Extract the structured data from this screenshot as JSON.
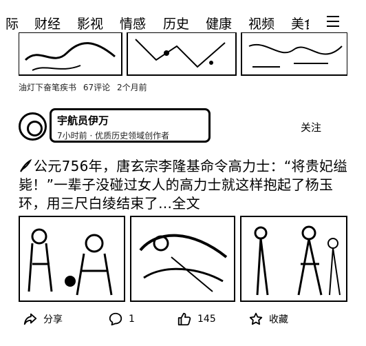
{
  "nav": {
    "tabs": [
      "际",
      "财经",
      "影视",
      "情感",
      "历史",
      "健康",
      "视频",
      "美食"
    ]
  },
  "prev_card": {
    "author": "油灯下奋笔疾书",
    "comments": "67评论",
    "time": "2个月前"
  },
  "author": {
    "name": "宇航员伊万",
    "subtitle": "7小时前 · 优质历史领域创作者",
    "follow": "关注"
  },
  "headline": "公元756年，唐玄宗李隆基命令高力士：“将贵妃缢毙！”一辈子没碰过女人的高力士就这样抱起了杨玉环，用三尺白绫结束了…全文",
  "actions": {
    "share": "分享",
    "comment": "1",
    "like": "145",
    "favorite": "收藏"
  },
  "icons": {
    "menu": "menu-icon",
    "avatar": "avatar",
    "headline_prefix": "feather-icon",
    "share": "share-icon",
    "comment": "comment-icon",
    "like": "thumbs-up-icon",
    "favorite": "star-icon"
  }
}
